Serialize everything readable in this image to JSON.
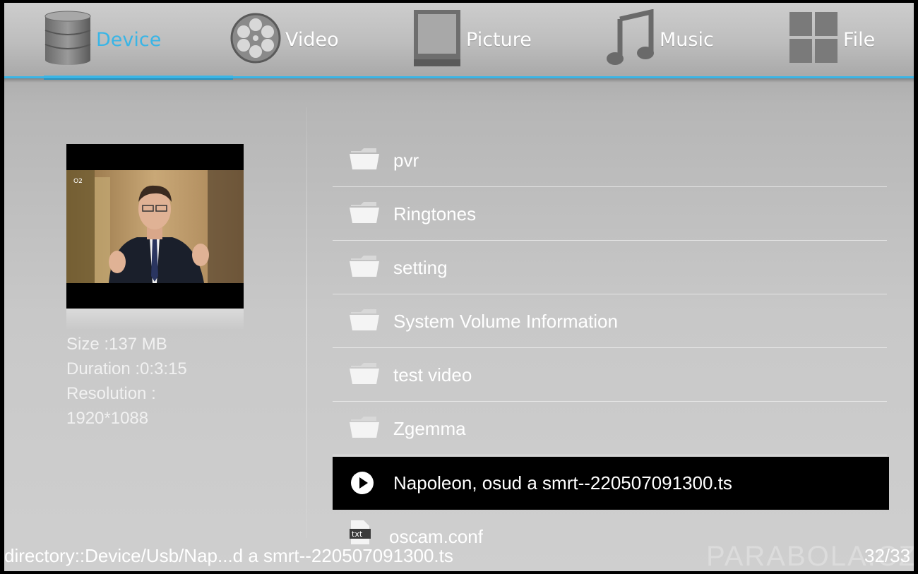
{
  "tabs": [
    {
      "label": "Device",
      "icon": "database-icon",
      "active": true
    },
    {
      "label": "Video",
      "icon": "film-reel-icon",
      "active": false
    },
    {
      "label": "Picture",
      "icon": "picture-frame-icon",
      "active": false
    },
    {
      "label": "Music",
      "icon": "music-note-icon",
      "active": false
    },
    {
      "label": "File",
      "icon": "grid-icon",
      "active": false
    }
  ],
  "colors": {
    "accent": "#39b5e6",
    "selected_row_bg": "#000000",
    "text": "#ffffff"
  },
  "info": {
    "size": "Size :137 MB",
    "duration": "Duration :0:3:15",
    "resolution_label": "Resolution :",
    "resolution_value": "1920*1088"
  },
  "files": [
    {
      "name": "pvr",
      "icon": "folder-icon"
    },
    {
      "name": "Ringtones",
      "icon": "folder-icon"
    },
    {
      "name": "setting",
      "icon": "folder-icon"
    },
    {
      "name": "System Volume Information",
      "icon": "folder-icon"
    },
    {
      "name": "test video",
      "icon": "folder-icon"
    },
    {
      "name": "Zgemma",
      "icon": "folder-icon"
    },
    {
      "name": "Napoleon, osud a smrt--220507091300.ts",
      "icon": "play-icon",
      "selected": true
    },
    {
      "name": "oscam.conf",
      "icon": "txt-file-icon"
    }
  ],
  "status": {
    "path": "directory::Device/Usb/Nap...d a smrt--220507091300.ts",
    "count": "32/33",
    "watermark": "PARABOLA.CZ"
  }
}
